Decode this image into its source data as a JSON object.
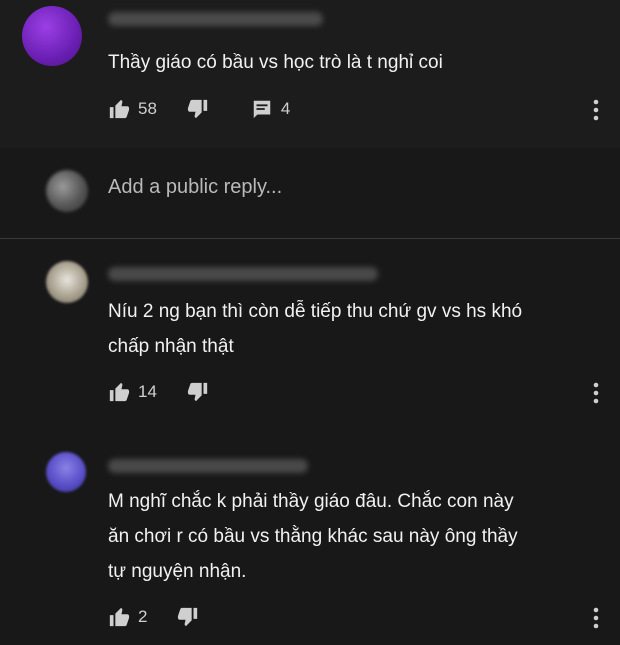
{
  "top_comment": {
    "text": "Thầy giáo có bầu vs học trò là t nghỉ coi",
    "likes": "58",
    "replies": "4",
    "avatar_color": "#6a1fb3"
  },
  "reply_input": {
    "placeholder": "Add a public reply..."
  },
  "replies": [
    {
      "text": "Níu 2 ng bạn thì còn dễ tiếp thu chứ gv vs hs khó\nchấp nhận thật",
      "likes": "14"
    },
    {
      "text": "M nghĩ chắc k phải thầy giáo đâu. Chắc con này\năn chơi r có bầu vs thằng khác sau này ông thầy\ntự nguyện nhận.",
      "likes": "2",
      "avatar_color": "#5a4fc8"
    }
  ]
}
